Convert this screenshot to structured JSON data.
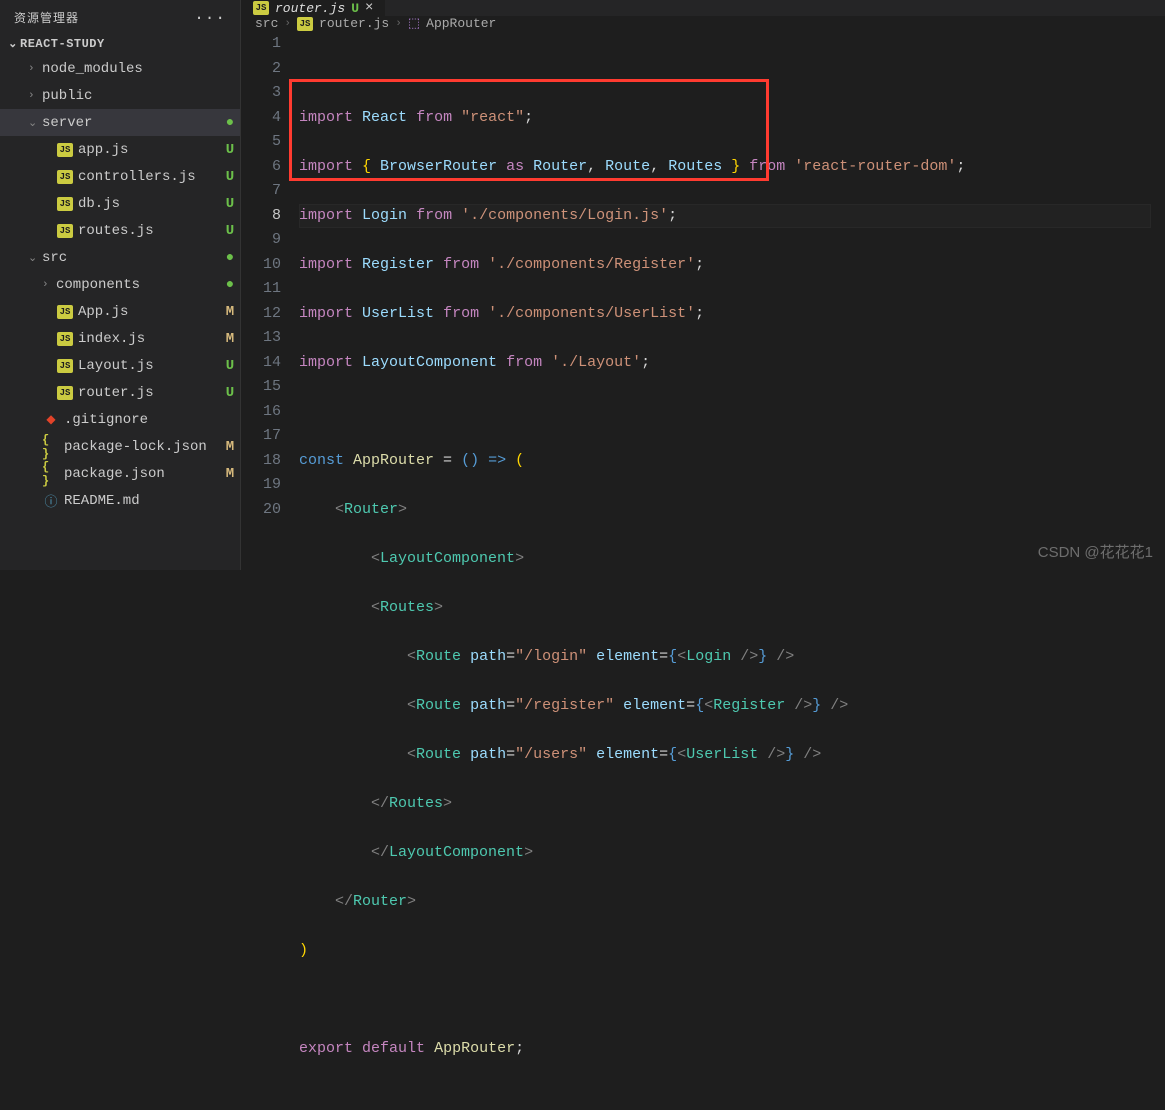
{
  "sidebar": {
    "title": "资源管理器",
    "more": "···",
    "project": "REACT-STUDY",
    "items": [
      {
        "kind": "folder",
        "label": "node_modules",
        "indent": 1,
        "chev": "›",
        "status": ""
      },
      {
        "kind": "folder",
        "label": "public",
        "indent": 1,
        "chev": "›",
        "status": ""
      },
      {
        "kind": "folder",
        "label": "server",
        "indent": 1,
        "chev": "⌄",
        "status": "●",
        "statusCls": "green-dot",
        "selected": true
      },
      {
        "kind": "js",
        "label": "app.js",
        "indent": 2,
        "status": "U",
        "statusCls": "status-U"
      },
      {
        "kind": "js",
        "label": "controllers.js",
        "indent": 2,
        "status": "U",
        "statusCls": "status-U"
      },
      {
        "kind": "js",
        "label": "db.js",
        "indent": 2,
        "status": "U",
        "statusCls": "status-U"
      },
      {
        "kind": "js",
        "label": "routes.js",
        "indent": 2,
        "status": "U",
        "statusCls": "status-U"
      },
      {
        "kind": "folder",
        "label": "src",
        "indent": 1,
        "chev": "⌄",
        "status": "●",
        "statusCls": "green-dot"
      },
      {
        "kind": "folder",
        "label": "components",
        "indent": 2,
        "chev": "›",
        "status": "●",
        "statusCls": "green-dot"
      },
      {
        "kind": "js",
        "label": "App.js",
        "indent": 2,
        "status": "M",
        "statusCls": "status-M"
      },
      {
        "kind": "js",
        "label": "index.js",
        "indent": 2,
        "status": "M",
        "statusCls": "status-M"
      },
      {
        "kind": "js",
        "label": "Layout.js",
        "indent": 2,
        "status": "U",
        "statusCls": "status-U"
      },
      {
        "kind": "js",
        "label": "router.js",
        "indent": 2,
        "status": "U",
        "statusCls": "status-U"
      },
      {
        "kind": "git",
        "label": ".gitignore",
        "indent": 1,
        "status": ""
      },
      {
        "kind": "json",
        "label": "package-lock.json",
        "indent": 1,
        "status": "M",
        "statusCls": "status-M"
      },
      {
        "kind": "json",
        "label": "package.json",
        "indent": 1,
        "status": "M",
        "statusCls": "status-M"
      },
      {
        "kind": "info",
        "label": "README.md",
        "indent": 1,
        "status": ""
      }
    ]
  },
  "tab": {
    "icon": "JS",
    "label": "router.js",
    "status": "U",
    "close": "×"
  },
  "breadcrumb": {
    "src": "src",
    "file": "router.js",
    "symbol": "AppRouter"
  },
  "editor": {
    "activeLine": 8,
    "lines": 20
  },
  "code": {
    "l1_import": "import",
    "l1_name": "React",
    "l1_from": "from",
    "l1_str": "\"react\"",
    "l1_semi": ";",
    "l2_import": "import",
    "l2_lb": "{ ",
    "l2_br": "BrowserRouter",
    "l2_as": "as",
    "l2_router": "Router",
    "l2_c1": ",",
    "l2_route": "Route",
    "l2_c2": ",",
    "l2_routes": "Routes",
    "l2_rb": " }",
    "l2_from": "from",
    "l2_str": "'react-router-dom'",
    "l2_semi": ";",
    "l3_import": "import",
    "l3_name": "Login",
    "l3_from": "from",
    "l3_str": "'./components/Login.js'",
    "l3_semi": ";",
    "l4_import": "import",
    "l4_name": "Register",
    "l4_from": "from",
    "l4_str": "'./components/Register'",
    "l4_semi": ";",
    "l5_import": "import",
    "l5_name": "UserList",
    "l5_from": "from",
    "l5_str": "'./components/UserList'",
    "l5_semi": ";",
    "l6_import": "import",
    "l6_name": "LayoutComponent",
    "l6_from": "from",
    "l6_str": "'./Layout'",
    "l6_semi": ";",
    "l8_const": "const",
    "l8_fn": "AppRouter",
    "l8_eq": " = ",
    "l8_paren": "()",
    "l8_arrow": " => ",
    "l8_open": "(",
    "l9": "<Router>",
    "l10": "<LayoutComponent>",
    "l11": "<Routes>",
    "l12_tag": "Route",
    "l12_attr_path": "path",
    "l12_str_path": "\"/login\"",
    "l12_attr_el": "element",
    "l12_comp": "Login",
    "l13_tag": "Route",
    "l13_attr_path": "path",
    "l13_str_path": "\"/register\"",
    "l13_attr_el": "element",
    "l13_comp": "Register",
    "l14_tag": "Route",
    "l14_attr_path": "path",
    "l14_str_path": "\"/users\"",
    "l14_attr_el": "element",
    "l14_comp": "UserList",
    "l15": "</Routes>",
    "l16": "</LayoutComponent>",
    "l17": "</Router>",
    "l18": ")",
    "l20_export": "export",
    "l20_default": "default",
    "l20_name": "AppRouter",
    "l20_semi": ";"
  },
  "watermark": "CSDN @花花花1"
}
